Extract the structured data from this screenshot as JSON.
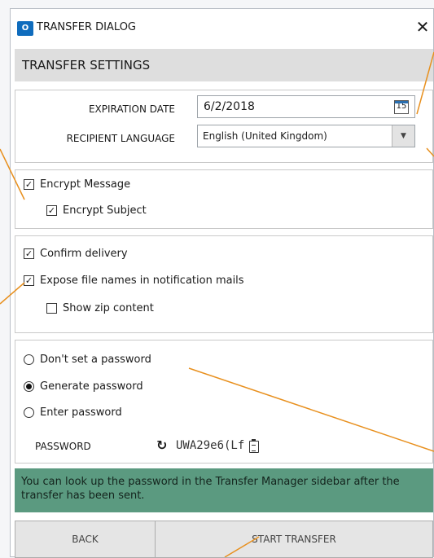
{
  "window": {
    "app_icon": "outlook-icon",
    "app_icon_text": "O",
    "title": "TRANSFER DIALOG",
    "close_glyph": "✕"
  },
  "settings": {
    "header": "TRANSFER SETTINGS",
    "expiration_label": "EXPIRATION DATE",
    "expiration_value": "6/2/2018",
    "calendar_day": "15",
    "language_label": "RECIPIENT LANGUAGE",
    "language_value": "English (United Kingdom)"
  },
  "encryption": {
    "encrypt_message": {
      "label": "Encrypt Message",
      "checked": true
    },
    "encrypt_subject": {
      "label": "Encrypt Subject",
      "checked": true
    }
  },
  "delivery": {
    "confirm_delivery": {
      "label": "Confirm delivery",
      "checked": true
    },
    "expose_filenames": {
      "label": "Expose file names in notification mails",
      "checked": true
    },
    "show_zip": {
      "label": "Show zip content",
      "checked": false
    }
  },
  "password": {
    "options": [
      {
        "label": "Don't set a password",
        "selected": false
      },
      {
        "label": "Generate password",
        "selected": true
      },
      {
        "label": "Enter password",
        "selected": false
      }
    ],
    "label": "PASSWORD",
    "value": "UWA29e6(Lf"
  },
  "info": {
    "text": "You can look up the password in the Transfer Manager sidebar after the transfer has been sent."
  },
  "footer": {
    "back_label": "BACK",
    "start_label": "START TRANSFER"
  },
  "colors": {
    "accent_annotation": "#e8901e",
    "banner_bg": "#5b9a80",
    "header_bg": "#dedede",
    "app_icon_bg": "#0f6cbd"
  }
}
